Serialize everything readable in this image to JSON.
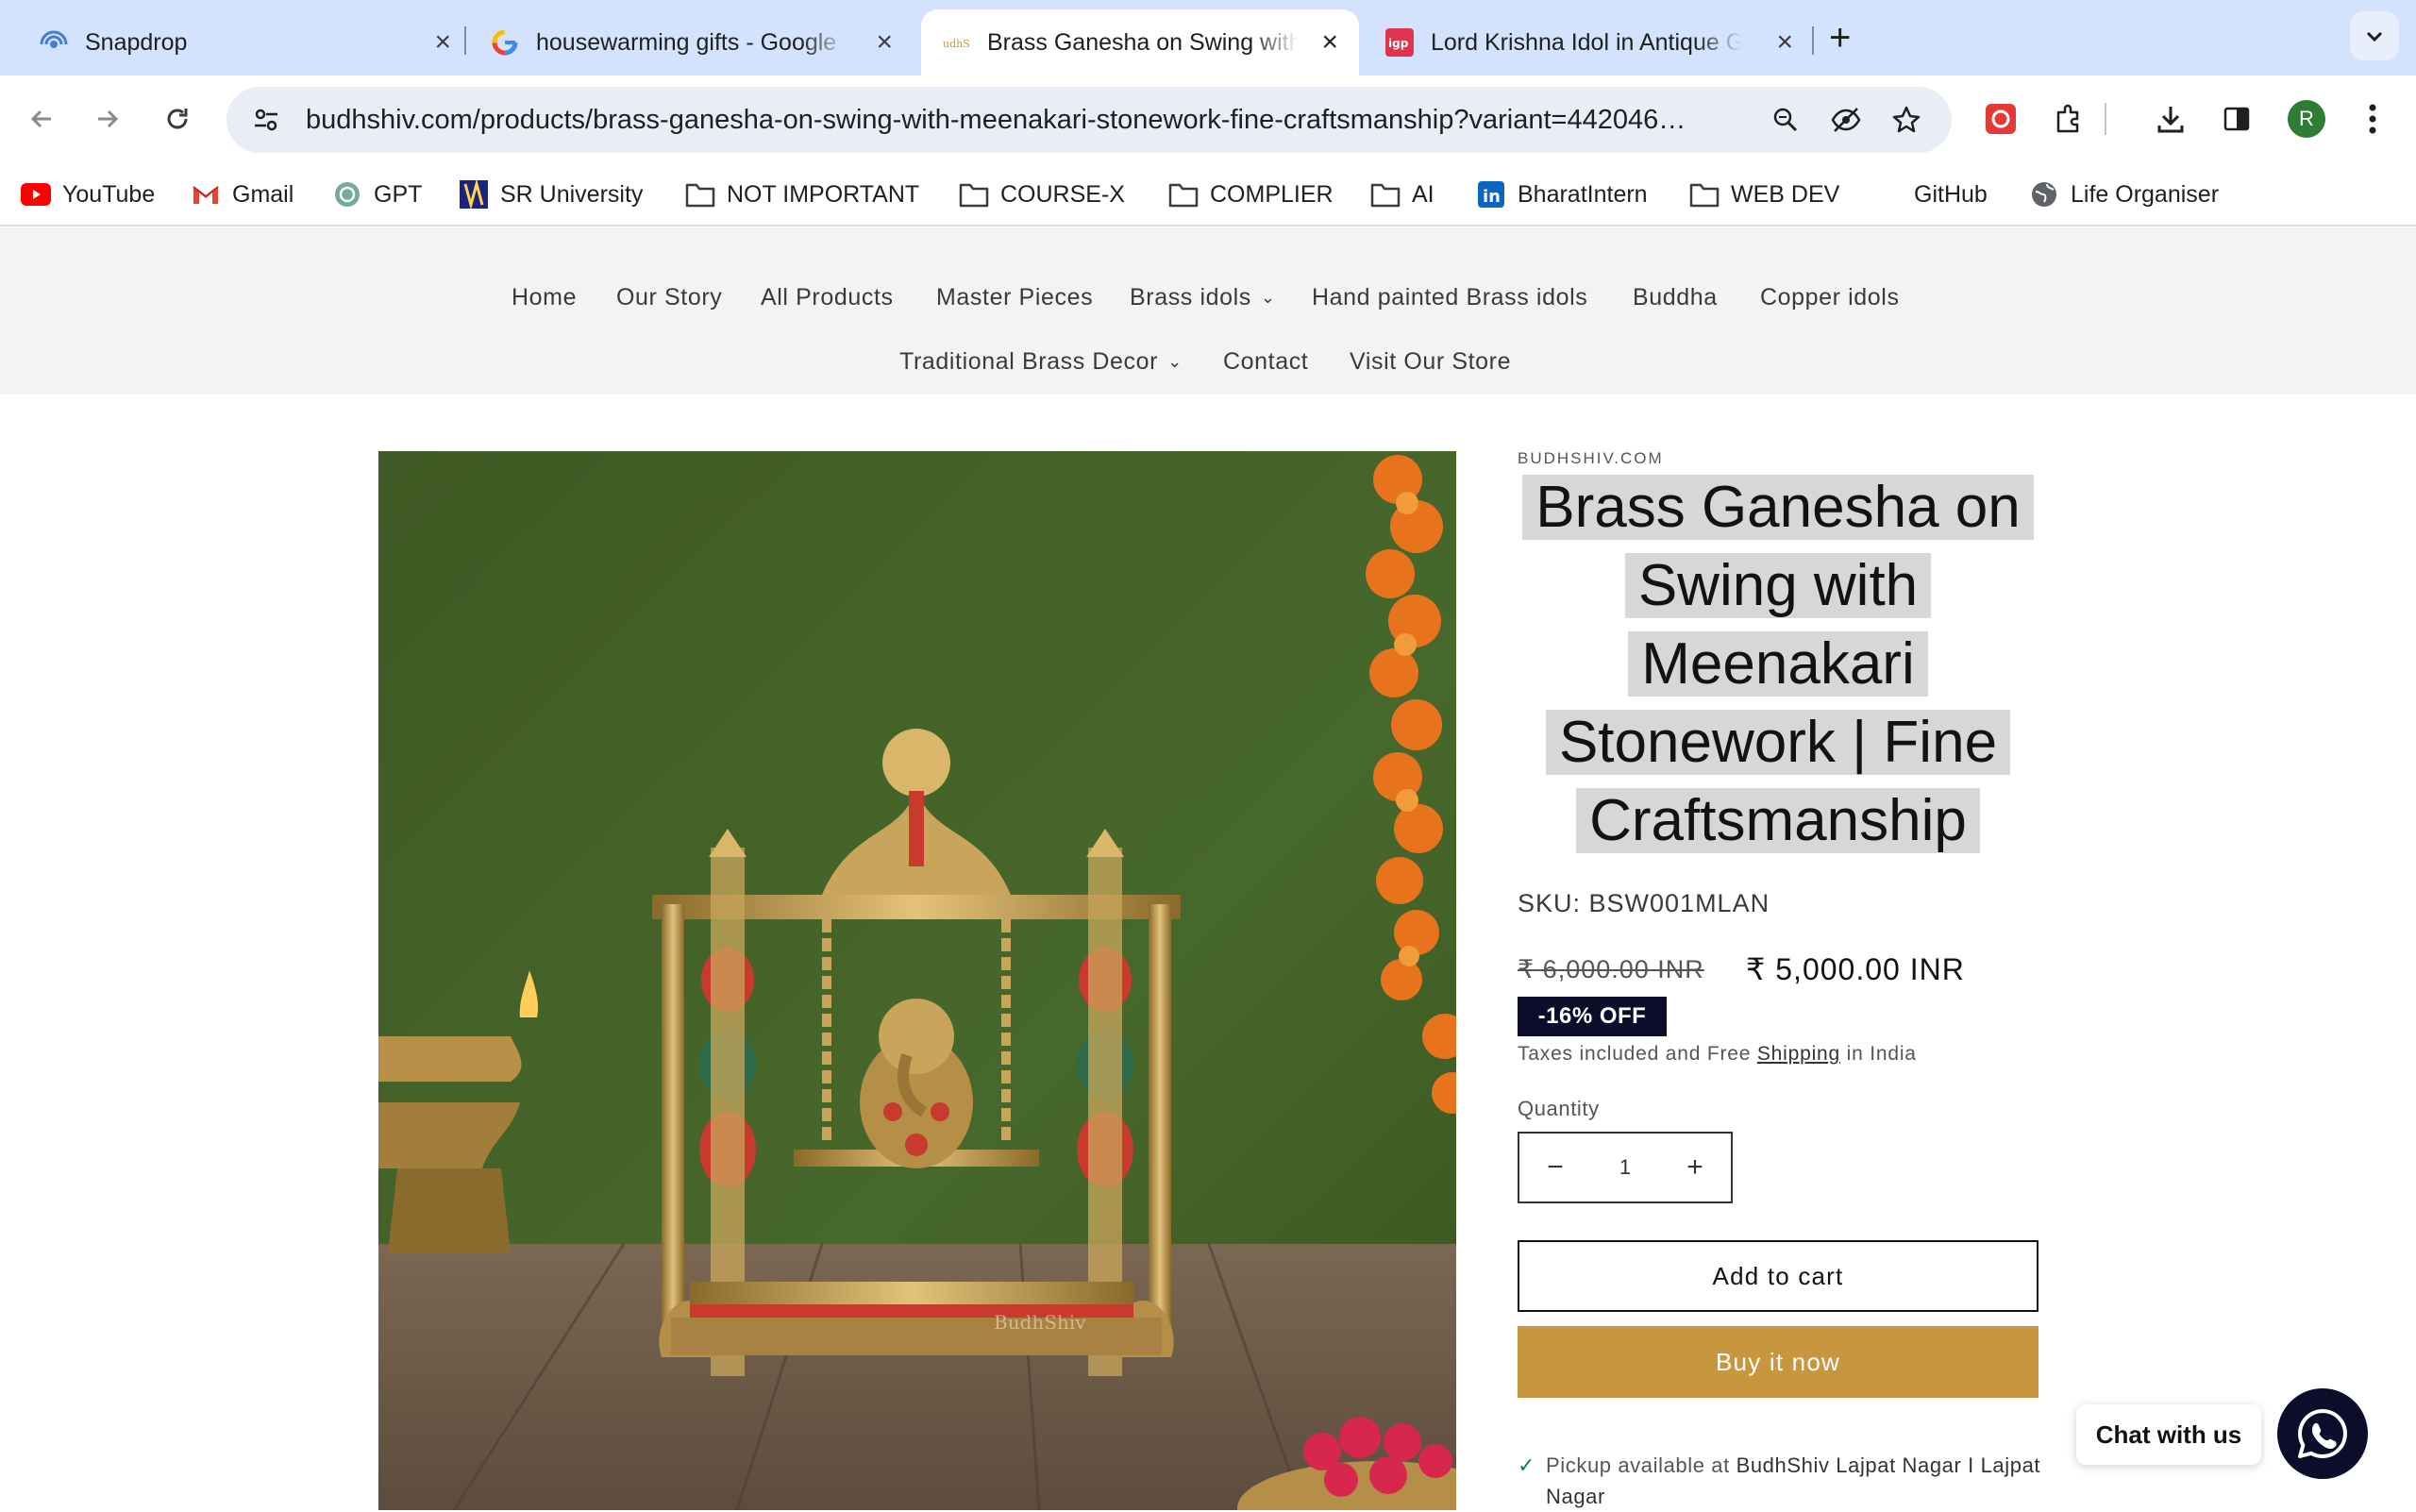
{
  "browser": {
    "tabs": [
      {
        "title": "Snapdrop",
        "favicon": "snapdrop-icon",
        "active": false
      },
      {
        "title": "housewarming gifts - Google Search",
        "favicon": "google-icon",
        "active": false
      },
      {
        "title": "Brass Ganesha on Swing with Meenakari",
        "favicon": "budhshiv-icon",
        "active": true
      },
      {
        "title": "Lord Krishna Idol in Antique Gold",
        "favicon": "igp-icon",
        "active": false
      }
    ],
    "url": "budhshiv.com/products/brass-ganesha-on-swing-with-meenakari-stonework-fine-craftsmanship?variant=442046…",
    "avatar_letter": "R",
    "bookmarks": [
      {
        "label": "YouTube",
        "icon": "youtube-icon"
      },
      {
        "label": "Gmail",
        "icon": "gmail-icon"
      },
      {
        "label": "GPT",
        "icon": "chatgpt-icon"
      },
      {
        "label": "SR University",
        "icon": "sr-university-icon"
      },
      {
        "label": "NOT IMPORTANT",
        "icon": "folder-icon"
      },
      {
        "label": "COURSE-X",
        "icon": "folder-icon"
      },
      {
        "label": "COMPLIER",
        "icon": "folder-icon"
      },
      {
        "label": "AI",
        "icon": "folder-icon"
      },
      {
        "label": "BharatIntern",
        "icon": "linkedin-icon"
      },
      {
        "label": "WEB DEV",
        "icon": "folder-icon"
      },
      {
        "label": "GitHub",
        "icon": "github-icon"
      },
      {
        "label": "Life Organiser",
        "icon": "globe-icon"
      }
    ]
  },
  "store": {
    "nav_row1": [
      "Home",
      "Our Story",
      "All Products",
      "Master Pieces",
      "Brass idols",
      "Hand painted Brass idols",
      "Buddha",
      "Copper idols"
    ],
    "nav_row2": [
      "Traditional Brass Decor",
      "Contact",
      "Visit Our Store"
    ]
  },
  "product": {
    "vendor": "BUDHSHIV.COM",
    "title_lines": [
      "Brass Ganesha on",
      "Swing with",
      "Meenakari",
      "Stonework | Fine",
      "Craftsmanship"
    ],
    "sku": "SKU: BSW001MLAN",
    "regular_price": "₹ 6,000.00 INR",
    "sale_price": "₹ 5,000.00 INR",
    "discount_badge": "-16% OFF",
    "tax_note_prefix": "Taxes included and Free",
    "tax_note_link": "Shipping",
    "tax_note_suffix": "in India",
    "quantity_label": "Quantity",
    "quantity_value": "1",
    "decrease": "−",
    "increase": "+",
    "add_to_cart": "Add to cart",
    "buy_now": "Buy it now",
    "pickup_prefix": "Pickup available at",
    "pickup_location": "BudhShiv Lajpat Nagar I Lajpat Nagar",
    "image_watermark": "BudhShiv"
  },
  "chat": {
    "label": "Chat with us"
  },
  "colors": {
    "accent": "#c8963e",
    "badge": "#0b0d2b",
    "tabstrip": "#d3e3fd"
  }
}
